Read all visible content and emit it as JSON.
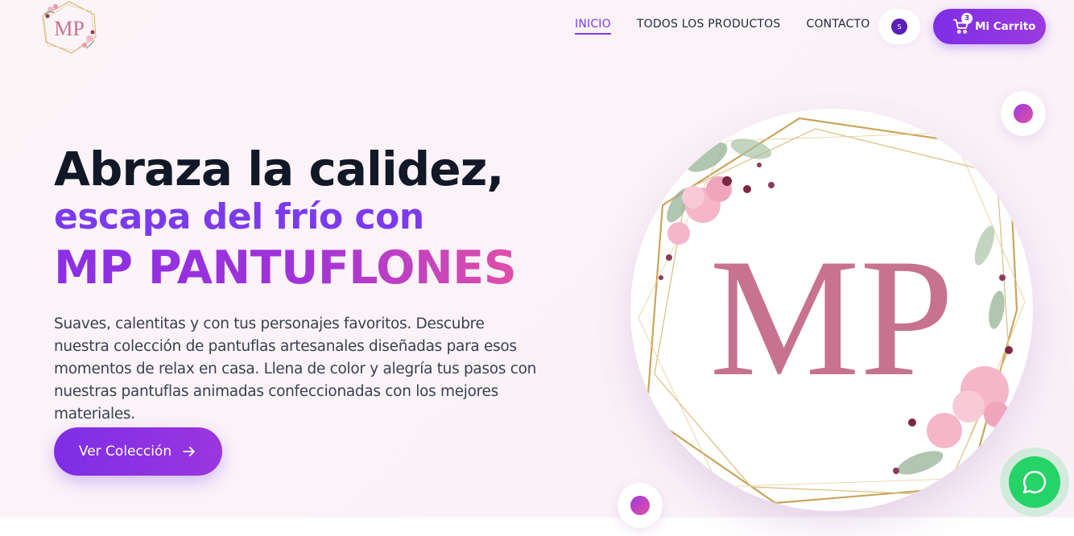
{
  "brand": {
    "logo_text": "MP",
    "logo_icon": "mp-floral-logo"
  },
  "nav": {
    "items": [
      {
        "label": "INICIO",
        "active": true
      },
      {
        "label": "TODOS LOS PRODUCTOS",
        "active": false
      },
      {
        "label": "CONTACTO",
        "active": false
      }
    ]
  },
  "user": {
    "avatar_initial": "S"
  },
  "cart": {
    "label": "Mi Carrito",
    "count": "3",
    "icon": "cart-icon"
  },
  "hero": {
    "title_line1": "Abraza la calidez,",
    "title_line2": "escapa del frío con",
    "title_line3": "MP PANTUFLONES",
    "description": "Suaves, calentitas y con tus personajes favoritos. Descubre nuestra colección de pantuflas artesanales diseñadas para esos momentos de relax en casa. Llena de color y alegría tus pasos con nuestras pantuflas animadas confeccionadas con los mejores materiales.",
    "cta_label": "Ver Colección",
    "cta_icon": "arrow-right-icon",
    "image_text": "MP"
  },
  "whatsapp": {
    "icon": "whatsapp-icon"
  },
  "colors": {
    "accent": "#7c3aed",
    "accent_pink": "#e050a8",
    "logo_rose": "#c7728f",
    "gold": "#c9a45a",
    "whatsapp": "#25d366"
  }
}
